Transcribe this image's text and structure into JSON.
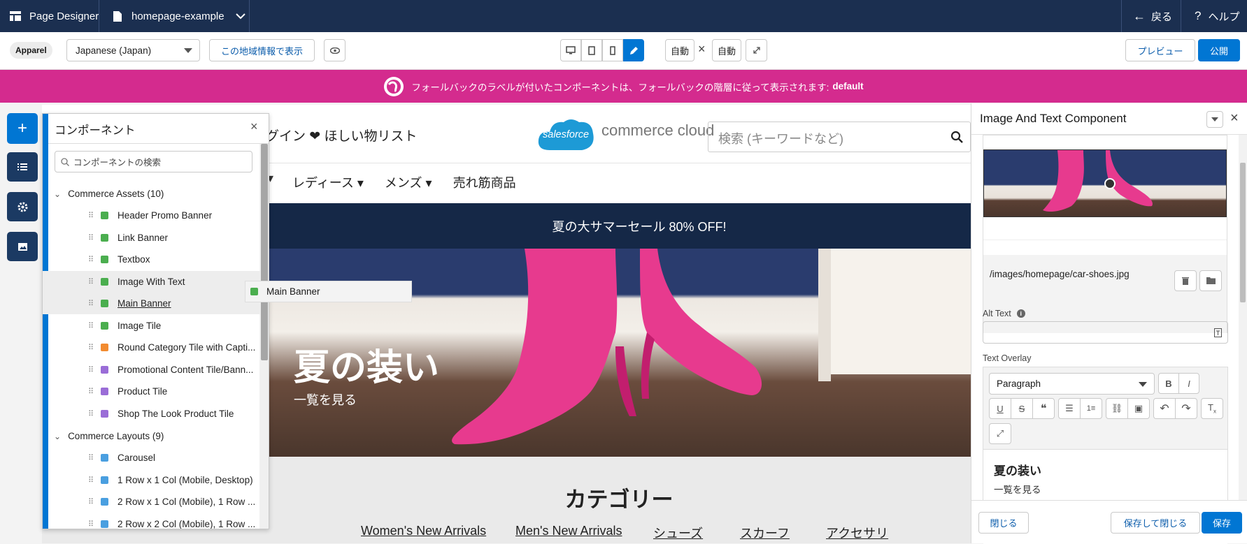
{
  "topbar": {
    "app_name": "Page Designer",
    "page_name": "homepage-example",
    "back_label": "戻る",
    "help_label": "ヘルプ"
  },
  "toolbar": {
    "site_badge": "Apparel",
    "locale_value": "Japanese (Japan)",
    "show_locale_button": "この地域情報で表示",
    "width_auto": "自動",
    "height_auto": "自動",
    "preview_label": "プレビュー",
    "publish_label": "公開"
  },
  "fallback_banner": {
    "text": "フォールバックのラベルが付いたコンポーネントは、フォールバックの階層に従って表示されます:",
    "value": "default"
  },
  "site": {
    "header_links": "グイン ❤ ほしい物リスト",
    "logo_cloud_text": "salesforce",
    "logo_text": "commerce cloud",
    "search_placeholder": "検索 (キーワードなど)",
    "nav": [
      "レディース",
      "メンズ",
      "売れ筋商品"
    ],
    "promo_text": "夏の大サマーセール 80% OFF!",
    "hero_title": "夏の装い",
    "hero_link": "一覧を見る",
    "category_heading": "カテゴリー",
    "category_links": [
      "Women's New Arrivals",
      "Men's New Arrivals",
      "シューズ",
      "スカーフ",
      "アクセサリ"
    ]
  },
  "components_panel": {
    "title": "コンポーネント",
    "search_placeholder": "コンポーネントの検索",
    "group1": "Commerce Assets (10)",
    "group1_items": [
      {
        "label": "Header Promo Banner",
        "color": "#4bae4f"
      },
      {
        "label": "Link Banner",
        "color": "#4bae4f"
      },
      {
        "label": "Textbox",
        "color": "#4bae4f"
      },
      {
        "label": "Image With Text",
        "color": "#4bae4f"
      },
      {
        "label": "Main Banner",
        "color": "#4bae4f"
      },
      {
        "label": "Image Tile",
        "color": "#4bae4f"
      },
      {
        "label": "Round Category Tile with Capti...",
        "color": "#f28b30"
      },
      {
        "label": "Promotional Content Tile/Bann...",
        "color": "#9a6dd7"
      },
      {
        "label": "Product Tile",
        "color": "#9a6dd7"
      },
      {
        "label": "Shop The Look Product Tile",
        "color": "#9a6dd7"
      }
    ],
    "group2": "Commerce Layouts (9)",
    "group2_items": [
      {
        "label": "Carousel",
        "color": "#4a9fe0"
      },
      {
        "label": "1 Row x 1 Col (Mobile, Desktop)",
        "color": "#4a9fe0"
      },
      {
        "label": "2 Row x 1 Col (Mobile), 1 Row ...",
        "color": "#4a9fe0"
      },
      {
        "label": "2 Row x 2 Col (Mobile), 1 Row ...",
        "color": "#4a9fe0"
      }
    ],
    "drag_label": "Main Banner"
  },
  "properties_panel": {
    "title": "Image And Text Component",
    "image_path": "/images/homepage/car-shoes.jpg",
    "alt_text_label": "Alt Text",
    "alt_text_value": "",
    "text_overlay_label": "Text Overlay",
    "paragraph_select": "Paragraph",
    "editor_heading": "夏の装い",
    "editor_line": "一覧を見る",
    "close_label": "閉じる",
    "save_close_label": "保存して閉じる",
    "save_label": "保存"
  },
  "colors": {
    "topbar": "#1b2f50",
    "fallback_banner": "#d42b8e",
    "brand": "#0176d3",
    "promo_bar": "#152847"
  }
}
